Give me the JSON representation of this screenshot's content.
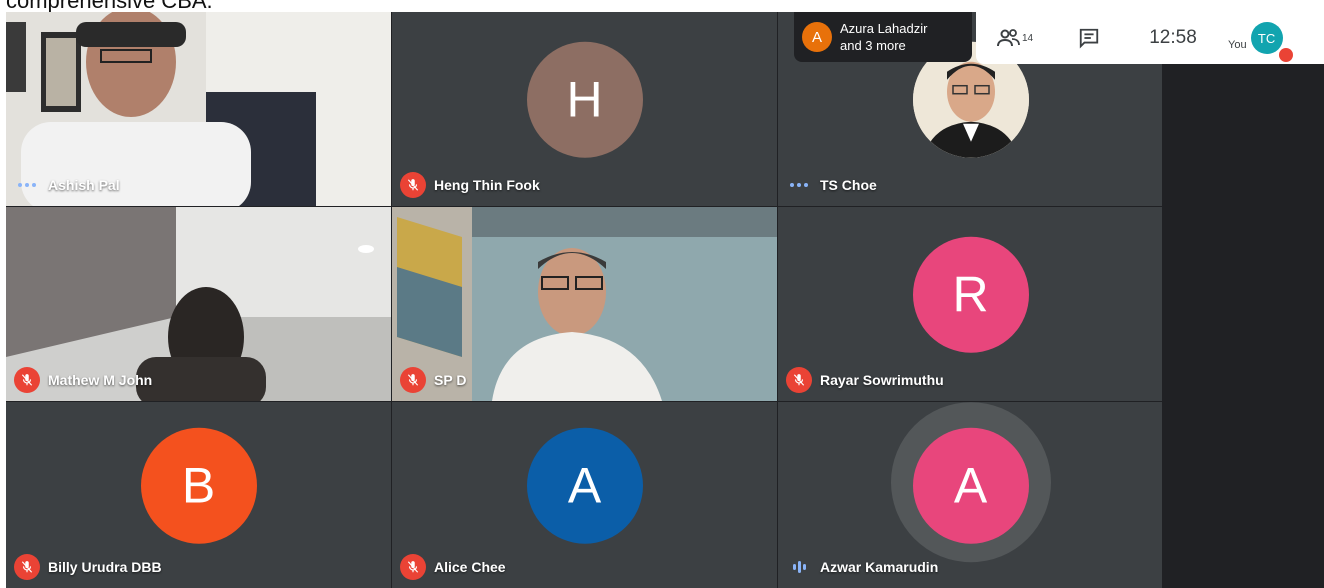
{
  "caption": "comprehensive CBA.",
  "notification": {
    "initial": "A",
    "line1": "Azura Lahadzir",
    "line2": "and 3 more",
    "color": "#e8710a"
  },
  "topbar": {
    "participants_count": "14",
    "time": "12:58",
    "you_label": "You",
    "user_initials": "TC"
  },
  "tiles": [
    {
      "name": "Ashish Pal",
      "status": "speaking-dots",
      "kind": "video"
    },
    {
      "name": "Heng Thin Fook",
      "status": "muted",
      "kind": "avatar",
      "initial": "H",
      "color": "#8d6e63"
    },
    {
      "name": "TS Choe",
      "status": "speaking-dots",
      "kind": "photo-avatar"
    },
    {
      "name": "Mathew M John",
      "status": "muted",
      "kind": "video"
    },
    {
      "name": "SP D",
      "status": "muted",
      "kind": "video"
    },
    {
      "name": "Rayar Sowrimuthu",
      "status": "muted",
      "kind": "avatar",
      "initial": "R",
      "color": "#e8467c"
    },
    {
      "name": "Billy Urudra DBB",
      "status": "muted",
      "kind": "avatar",
      "initial": "B",
      "color": "#f4511e"
    },
    {
      "name": "Alice Chee",
      "status": "muted",
      "kind": "avatar",
      "initial": "A",
      "color": "#0b5ea8"
    },
    {
      "name": "Azwar Kamarudin",
      "status": "speaking-bars",
      "kind": "avatar",
      "initial": "A",
      "color": "#e8467c"
    }
  ],
  "icons": {
    "mic_off": "mic-off-icon",
    "participants": "people-icon",
    "chat": "chat-icon"
  }
}
